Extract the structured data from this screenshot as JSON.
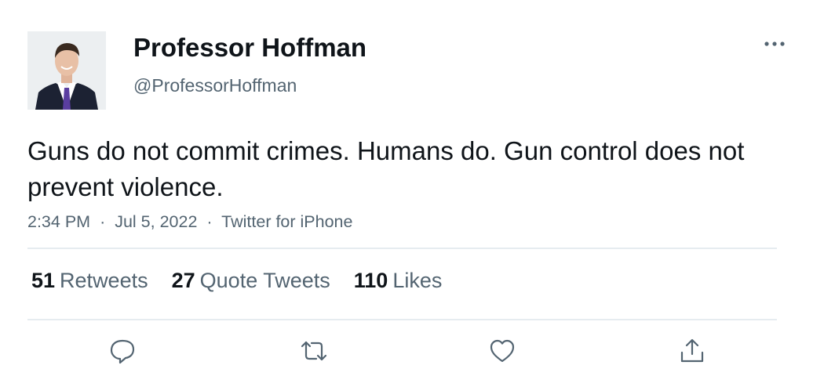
{
  "tweet": {
    "author": {
      "display_name": "Professor Hoffman",
      "handle": "@ProfessorHoffman",
      "avatar_icon": "profile-photo"
    },
    "text": "Guns do not commit crimes. Humans do. Gun control does not prevent violence.",
    "time": "2:34 PM",
    "date": "Jul 5, 2022",
    "source": "Twitter for iPhone",
    "separator": "·",
    "stats": {
      "retweets_count": "51",
      "retweets_label": "Retweets",
      "quotes_count": "27",
      "quotes_label": "Quote Tweets",
      "likes_count": "110",
      "likes_label": "Likes"
    },
    "actions": [
      "reply-icon",
      "retweet-icon",
      "like-icon",
      "share-icon"
    ],
    "more_icon": "more-icon"
  },
  "colors": {
    "primary_text": "#0f1419",
    "secondary_text": "#536471",
    "divider": "#e6ecf0"
  }
}
